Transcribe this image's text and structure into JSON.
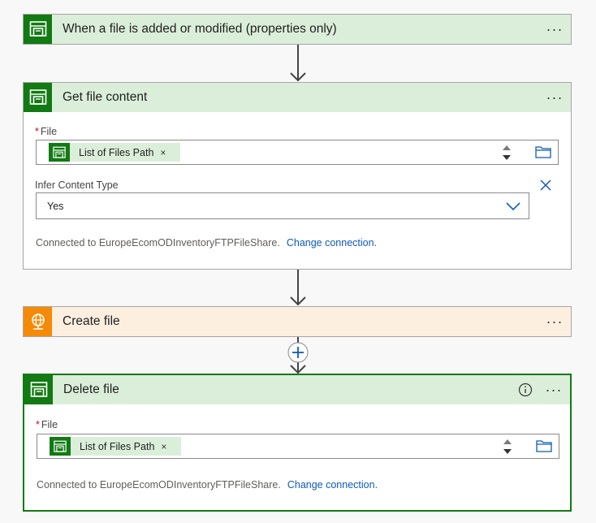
{
  "trigger": {
    "title": "When a file is added or modified (properties only)",
    "menu": "···"
  },
  "get_file_content": {
    "title": "Get file content",
    "menu": "···",
    "file_field": {
      "required_mark": "*",
      "label": "File",
      "token_label": "List of Files Path",
      "token_remove": "×"
    },
    "infer_field": {
      "label": "Infer Content Type",
      "value": "Yes"
    },
    "connection": {
      "text": "Connected to EuropeEcomODInventoryFTPFileShare.",
      "change_label": "Change connection."
    }
  },
  "create_file": {
    "title": "Create file",
    "menu": "···"
  },
  "delete_file": {
    "title": "Delete file",
    "menu": "···",
    "file_field": {
      "required_mark": "*",
      "label": "File",
      "token_label": "List of Files Path",
      "token_remove": "×"
    },
    "connection": {
      "text": "Connected to EuropeEcomODInventoryFTPFileShare.",
      "change_label": "Change connection."
    }
  },
  "colors": {
    "sharepoint_green": "#127a12",
    "header_green": "#dbeeda",
    "ftp_orange": "#f58a07",
    "header_orange": "#fdefe0",
    "link_blue": "#0f5ab4"
  },
  "icons": {
    "connector": "file-share-icon",
    "ftp": "ftp-globe-icon",
    "add": "plus-circle-icon",
    "info": "info-icon"
  }
}
